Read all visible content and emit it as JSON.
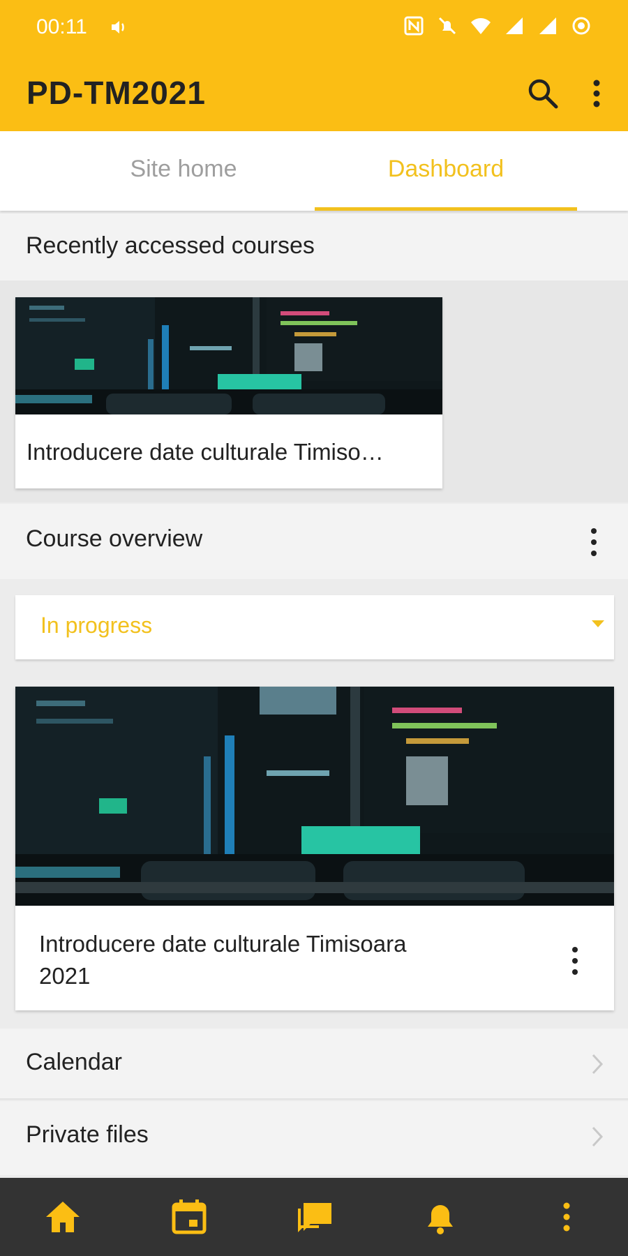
{
  "status_bar": {
    "time": "00:11"
  },
  "app_bar": {
    "title": "PD-TM2021"
  },
  "tabs": [
    {
      "label": "Site home",
      "active": false
    },
    {
      "label": "Dashboard",
      "active": true
    }
  ],
  "recent": {
    "heading": "Recently accessed courses",
    "course_name": "Introducere date culturale Timiso…"
  },
  "overview": {
    "heading": "Course overview",
    "filter_value": "In progress",
    "course_name_line1": "Introducere date culturale Timisoara",
    "course_name_line2": "2021"
  },
  "links": {
    "calendar": "Calendar",
    "private_files": "Private files"
  },
  "bottom_nav": [
    "home-icon",
    "calendar-icon",
    "messages-icon",
    "notifications-icon",
    "more-icon"
  ],
  "colors": {
    "accent": "#fbbe14",
    "accent_text": "#f2c11e",
    "nav_bg": "#333333"
  }
}
